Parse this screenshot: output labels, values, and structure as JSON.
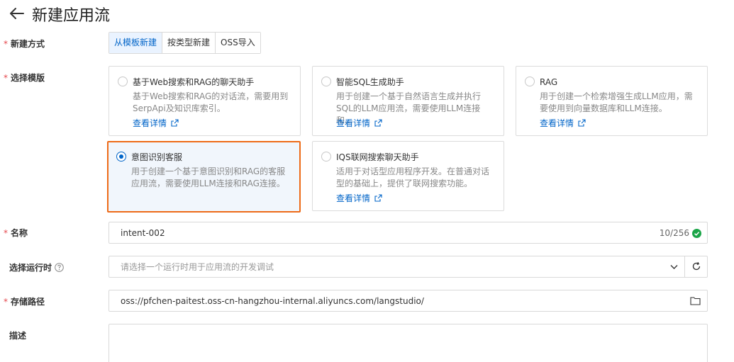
{
  "header": {
    "title": "新建应用流",
    "back_icon": "arrow-left-icon"
  },
  "form": {
    "method": {
      "label": "新建方式",
      "required": "*",
      "options": [
        {
          "label": "从模板新建",
          "active": true
        },
        {
          "label": "按类型新建",
          "active": false
        },
        {
          "label": "OSS导入",
          "active": false
        }
      ]
    },
    "template": {
      "label": "选择模版",
      "required": "*",
      "cards": [
        {
          "title": "基于Web搜索和RAG的聊天助手",
          "desc": "基于Web搜索和RAG的对话流，需要用到SerpApi及知识库索引。",
          "link": "查看详情",
          "selected": false
        },
        {
          "title": "智能SQL生成助手",
          "desc": "用于创建一个基于自然语言生成并执行SQL的LLM应用流，需要使用LLM连接和...",
          "link": "查看详情",
          "selected": false
        },
        {
          "title": "RAG",
          "desc": "用于创建一个检索增强生成LLM应用，需要使用到向量数据库和LLM连接。",
          "link": "查看详情",
          "selected": false
        },
        {
          "title": "意图识别客服",
          "desc": "用于创建一个基于意图识别和RAG的客服应用流，需要使用LLM连接和RAG连接。",
          "link": "",
          "selected": true
        },
        {
          "title": "IQS联网搜索聊天助手",
          "desc": "适用于对话型应用程序开发。在普通对话型的基础上，提供了联网搜索功能。",
          "link": "查看详情",
          "selected": false
        }
      ]
    },
    "name": {
      "label": "名称",
      "required": "*",
      "value": "intent-002",
      "counter": "10/256"
    },
    "runtime": {
      "label": "选择运行时",
      "placeholder": "请选择一个运行时用于应用流的开发调试"
    },
    "storage": {
      "label": "存储路径",
      "required": "*",
      "value": "oss://pfchen-paitest.oss-cn-hangzhou-internal.aliyuncs.com/langstudio/"
    },
    "description": {
      "label": "描述"
    }
  },
  "colors": {
    "accent": "#0064c8",
    "selected_border": "#ee6a17",
    "required": "#e5484d",
    "success": "#1ba548"
  }
}
